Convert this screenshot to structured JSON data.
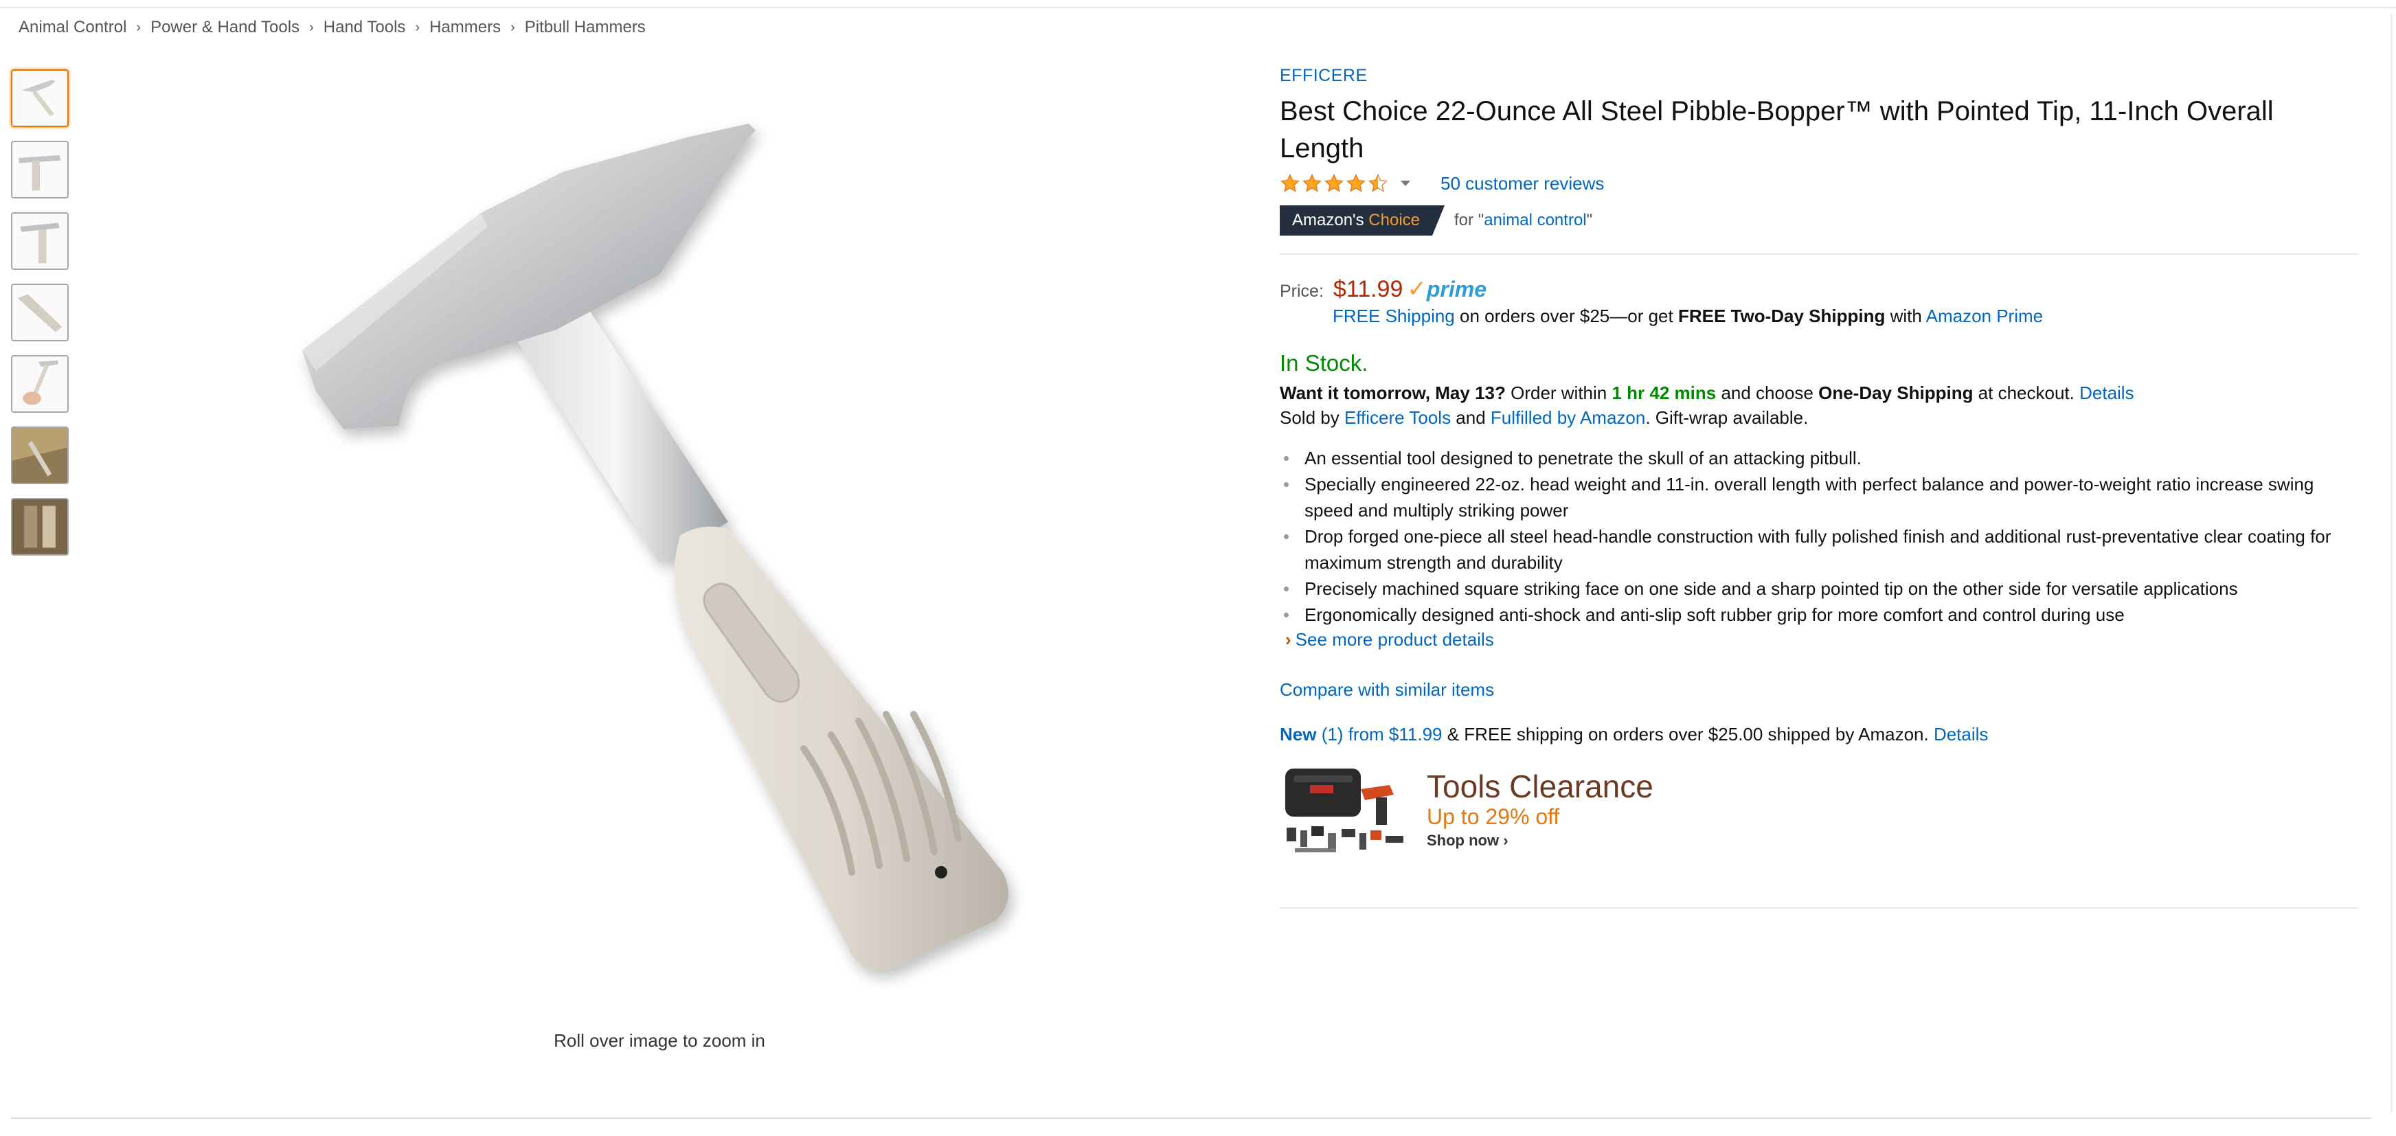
{
  "breadcrumb": [
    "Animal Control",
    "Power & Hand Tools",
    "Hand Tools",
    "Hammers",
    "Pitbull Hammers"
  ],
  "breadcrumb_separator": "›",
  "thumbnails": [
    {
      "icon": "hammer-thumb-icon",
      "active": true
    },
    {
      "icon": "hammer-side-thumb-icon",
      "active": false
    },
    {
      "icon": "hammer-front-thumb-icon",
      "active": false
    },
    {
      "icon": "hammer-angle-thumb-icon",
      "active": false
    },
    {
      "icon": "hammer-in-hand-thumb-icon",
      "active": false
    },
    {
      "icon": "hammer-in-use-thumb-icon",
      "active": false
    },
    {
      "icon": "hammer-packaging-thumb-icon",
      "active": false
    }
  ],
  "main_image": {
    "icon": "hammer-product-image"
  },
  "zoom_hint": "Roll over image to zoom in",
  "product": {
    "brand": "EFFICERE",
    "title": "Best Choice 22-Ounce All Steel Pibble-Bopper™ with Pointed Tip, 11-Inch Overall Length",
    "rating": 4.5,
    "reviews_label": "50 customer reviews",
    "choice_badge_prefix": "Amazon's",
    "choice_badge_word": "Choice",
    "choice_for_prefix": "for \"",
    "choice_for_link": "animal control",
    "choice_for_suffix": "\"",
    "price_label": "Price:",
    "price": "$11.99",
    "prime_check": "✓",
    "prime_word": "prime",
    "shipping_link": "FREE Shipping",
    "shipping_mid": " on orders over $25—or get ",
    "shipping_bold": "FREE Two-Day Shipping",
    "shipping_with": " with ",
    "shipping_prime_link": "Amazon Prime",
    "stock": "In Stock.",
    "delivery_bold": "Want it tomorrow, May 13?",
    "delivery_mid": " Order within ",
    "delivery_time": "1 hr 42 mins",
    "delivery_and": " and choose ",
    "delivery_option": "One-Day Shipping",
    "delivery_end": " at checkout. ",
    "delivery_details": "Details",
    "sold_by_prefix": "Sold by ",
    "seller": "Efficere Tools",
    "sold_and": " and ",
    "fulfilled": "Fulfilled by Amazon",
    "gift": ". Gift-wrap available.",
    "bullets": [
      "An essential tool designed to penetrate the skull of an attacking pitbull.",
      "Specially engineered 22-oz. head weight and 11-in. overall length with perfect balance and power-to-weight ratio increase swing speed and multiply striking power",
      "Drop forged one-piece all steel head-handle construction with fully polished finish and additional rust-preventative clear coating for maximum strength and durability",
      "Precisely machined square striking face on one side and a sharp pointed tip on the other side for versatile applications",
      "Ergonomically designed anti-shock and anti-slip soft rubber grip for more comfort and control during use"
    ],
    "see_more_chevron": "›",
    "see_more": "See more product details",
    "compare": "Compare with similar items",
    "new_word": "New",
    "new_link": " (1) from $11.99",
    "new_mid": " & FREE shipping on orders over $25.00 shipped by Amazon. ",
    "new_details": "Details"
  },
  "ad": {
    "title": "Tools Clearance",
    "subtitle": "Up to 29% off",
    "cta": "Shop now ›",
    "icon": "tool-kit-ad-image"
  },
  "colors": {
    "link": "#0066c0",
    "price": "#b12704",
    "stock": "#008a00",
    "thumb_active": "#e77600",
    "badge": "#232f3e",
    "badge_accent": "#f69931",
    "prime": "#2e9cd5"
  }
}
